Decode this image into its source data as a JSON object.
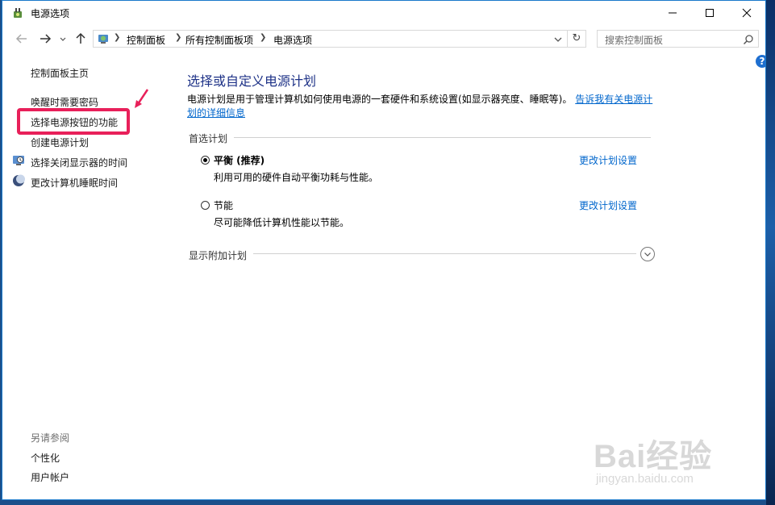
{
  "window": {
    "title": "电源选项"
  },
  "address": {
    "crumbs": [
      "控制面板",
      "所有控制面板项",
      "电源选项"
    ],
    "search_placeholder": "搜索控制面板"
  },
  "left_pane": {
    "home": "控制面板主页",
    "links": [
      "唤醒时需要密码",
      "选择电源按钮的功能",
      "创建电源计划",
      "选择关闭显示器的时间",
      "更改计算机睡眠时间"
    ],
    "see_also_title": "另请参阅",
    "see_also": [
      "个性化",
      "用户帐户"
    ]
  },
  "main": {
    "title": "选择或自定义电源计划",
    "description": "电源计划是用于管理计算机如何使用电源的一套硬件和系统设置(如显示器亮度、睡眠等)。",
    "more_info_link_1": "告诉我有关电源计",
    "more_info_link_2": "划的详细信息",
    "preferred_group": "首选计划",
    "plans": [
      {
        "name": "平衡 (推荐)",
        "desc": "利用可用的硬件自动平衡功耗与性能。",
        "link": "更改计划设置",
        "selected": true
      },
      {
        "name": "节能",
        "desc": "尽可能降低计算机性能以节能。",
        "link": "更改计划设置",
        "selected": false
      }
    ],
    "extra_group": "显示附加计划"
  },
  "help_label": "?",
  "colors": {
    "highlight": "#e8205a",
    "link": "#0066cc",
    "heading": "#1e3287"
  },
  "watermark": {
    "brand": "Bai经验",
    "url": "jingyan.baidu.com"
  }
}
